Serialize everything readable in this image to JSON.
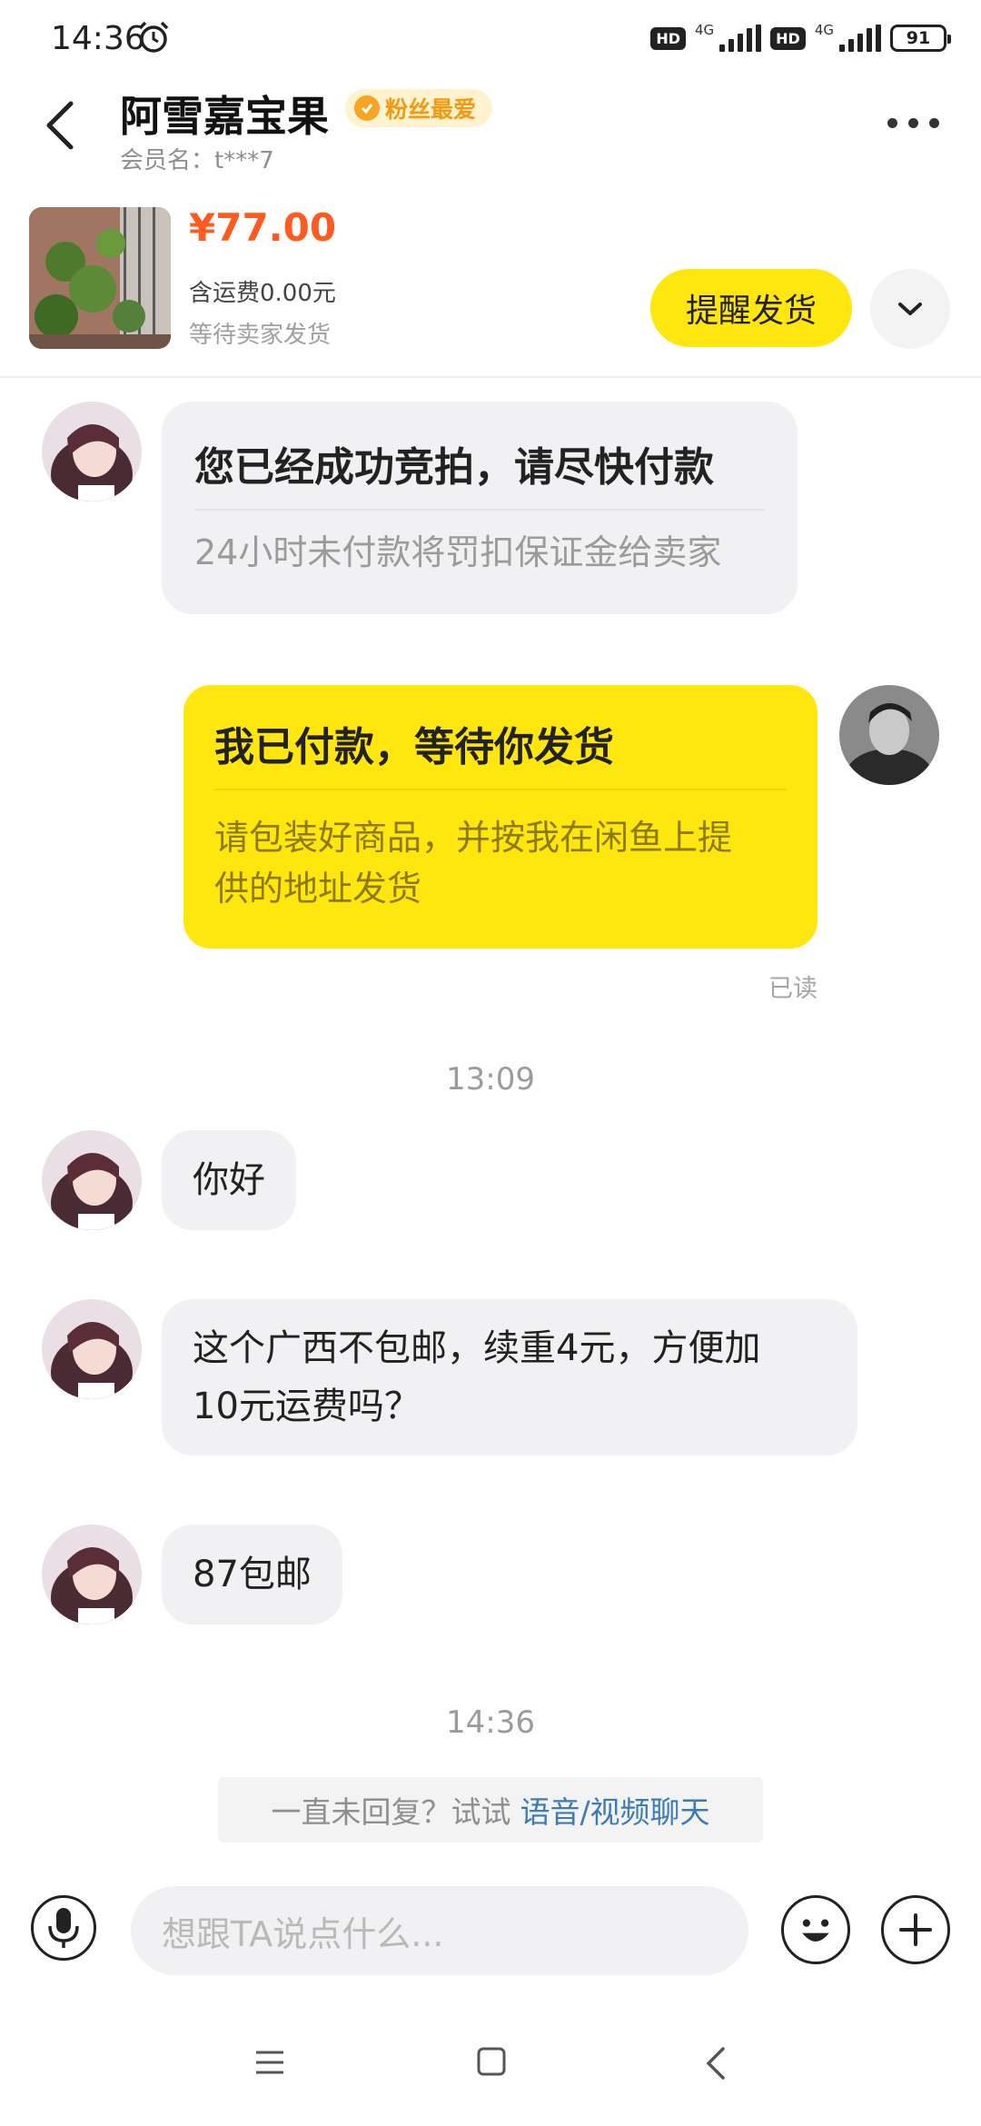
{
  "status_bar": {
    "time": "14:36",
    "alarm_icon": "alarm-icon",
    "hd_1": "HD",
    "network_1": "4G",
    "hd_2": "HD",
    "network_2": "4G",
    "battery": "91"
  },
  "header": {
    "back_icon": "chevron-left-icon",
    "seller_name": "阿雪嘉宝果",
    "badge_label": "粉丝最爱",
    "member_label": "会员名：t***7",
    "more_icon": "more-horizontal-icon"
  },
  "product": {
    "price": "¥77.00",
    "shipping": "含运费0.00元",
    "status": "等待卖家发货",
    "remind_button": "提醒发货",
    "expand_icon": "chevron-down-icon"
  },
  "messages": [
    {
      "sender": "seller",
      "type": "card",
      "title": "您已经成功竞拍，请尽快付款",
      "body": "24小时未付款将罚扣保证金给卖家"
    },
    {
      "sender": "me",
      "type": "card",
      "title": "我已付款，等待你发货",
      "body_line1": "请包装好商品，并按我在闲鱼上提",
      "body_line2": "供的地址发货",
      "read_status": "已读"
    },
    {
      "type": "time",
      "text": "13:09"
    },
    {
      "sender": "seller",
      "type": "text",
      "text": "你好"
    },
    {
      "sender": "seller",
      "type": "text",
      "line1": "这个广西不包邮，续重4元，方便加",
      "line2": "10元运费吗？"
    },
    {
      "sender": "seller",
      "type": "text",
      "text": "87包邮"
    },
    {
      "type": "time",
      "text": "14:36"
    }
  ],
  "hint": {
    "text": "一直未回复？试试",
    "link": "语音/视频聊天"
  },
  "input_bar": {
    "placeholder": "想跟TA说点什么...",
    "mic_icon": "microphone-icon",
    "emoji_icon": "emoji-icon",
    "plus_icon": "plus-icon"
  },
  "nav_bar": {
    "menu_icon": "menu-icon",
    "home_icon": "home-square-icon",
    "back_icon": "back-triangle-icon"
  },
  "colors": {
    "accent_yellow": "#ffe60f",
    "price_orange": "#ff5a1f",
    "badge_orange": "#f39a13",
    "link_blue": "#3d7bb6",
    "bubble_grey": "#f1f1f3"
  }
}
